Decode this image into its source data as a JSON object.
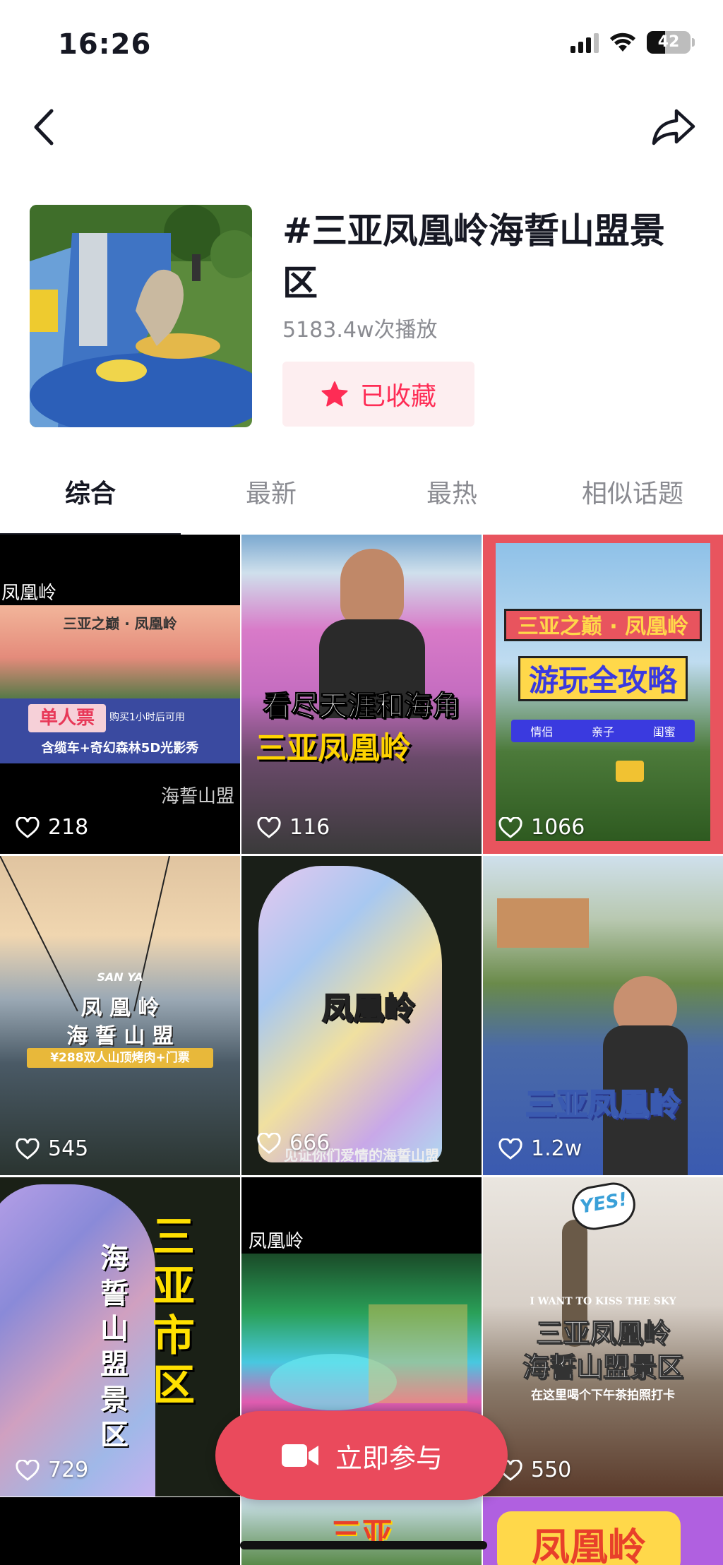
{
  "status_bar": {
    "time": "16:26",
    "battery": "42",
    "battery_level": 0.42,
    "icons": [
      "signal-icon",
      "wifi-icon",
      "battery-icon"
    ]
  },
  "nav": {
    "back_icon": "chevron-left-icon",
    "share_icon": "share-arrow-icon"
  },
  "topic": {
    "title": "#三亚凤凰岭海誓山盟景区",
    "plays": "5183.4w次播放",
    "favorite_label": "已收藏",
    "favorite_icon": "star-icon",
    "accent_color": "#fe2c55"
  },
  "tabs": [
    {
      "label": "综合",
      "active": true
    },
    {
      "label": "最新",
      "active": false
    },
    {
      "label": "最热",
      "active": false
    },
    {
      "label": "相似话题",
      "active": false
    }
  ],
  "videos": [
    {
      "likes": "218",
      "tag_top": "凤凰岭",
      "line1": "三亚之巅 · 凤凰岭",
      "ticket": "单人票",
      "ticket_note": "购买1小时后可用",
      "line2": "含缆车+奇幻森林5D光影秀",
      "tag_bottom": "海誓山盟"
    },
    {
      "likes": "116",
      "line1": "看尽天涯和海角",
      "line2": "三亚凤凰岭"
    },
    {
      "likes": "1066",
      "line1": "三亚之巅 · 凤凰岭",
      "line2": "游玩全攻略",
      "chips": [
        "情侣",
        "亲子",
        "闺蜜"
      ]
    },
    {
      "likes": "545",
      "line0": "SAN YA",
      "line1": "凤 凰 岭",
      "line2": "海 誓 山 盟",
      "line3": "¥288双人山顶烤肉+门票"
    },
    {
      "likes": "666",
      "line1": "凤凰岭",
      "line2": "见证你们爱情的海誓山盟"
    },
    {
      "likes": "1.2w",
      "line1": "三亚凤凰岭"
    },
    {
      "likes": "729",
      "line1": "三亚市区",
      "line2": "海誓山盟景区"
    },
    {
      "likes": "",
      "tag_top": "凤凰岭"
    },
    {
      "likes": "550",
      "bubble": "YES!",
      "line0": "I WANT TO KISS THE SKY",
      "line1": "三亚凤凰岭",
      "line2": "海誓山盟景区",
      "line3": "在这里喝个下午茶拍照打卡"
    }
  ],
  "partial_videos": [
    {
      "line1": ""
    },
    {
      "line1": "三亚"
    },
    {
      "line1": "凤凰岭"
    }
  ],
  "join_button": {
    "label": "立即参与",
    "icon": "video-camera-icon"
  }
}
